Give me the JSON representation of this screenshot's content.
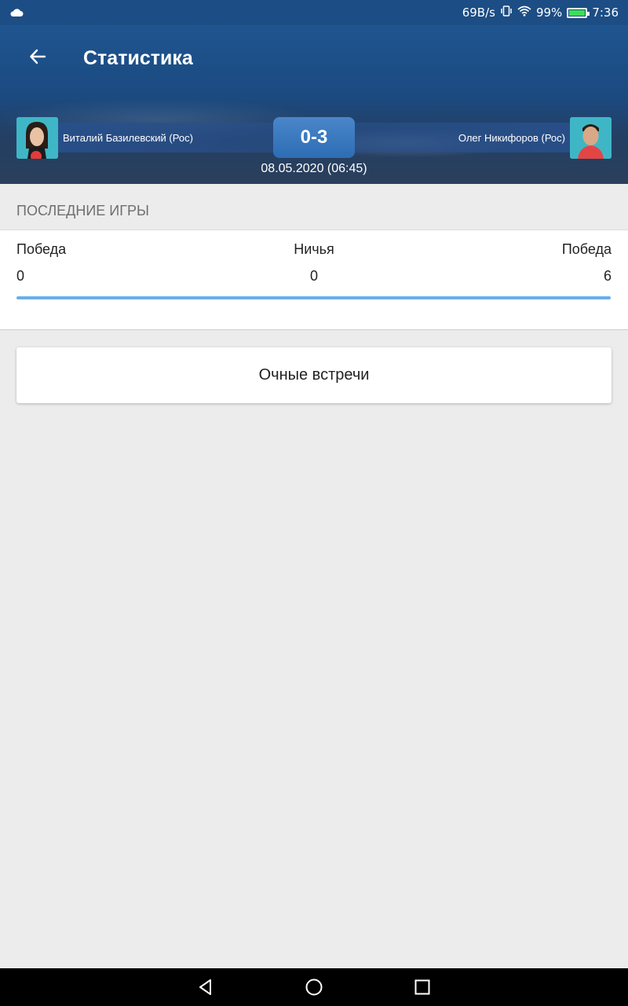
{
  "status_bar": {
    "net_speed": "69B/s",
    "battery_percent": "99%",
    "time": "7:36",
    "icons": [
      "cloud-icon",
      "vibrate-icon",
      "wifi-icon",
      "battery-icon"
    ],
    "battery_level": 0.99
  },
  "header": {
    "title": "Статистика",
    "back_icon": "arrow-left-icon",
    "accent_color": "#1f5590"
  },
  "match": {
    "player_left": "Виталий Базилевский (Рос)",
    "player_right": "Олег Никифоров (Рос)",
    "score": "0-3",
    "date": "08.05.2020 (06:45)"
  },
  "last_games": {
    "section_title": "ПОСЛЕДНИЕ ИГРЫ",
    "left_label": "Победа",
    "center_label": "Ничья",
    "right_label": "Победа",
    "left_value": "0",
    "center_value": "0",
    "right_value": "6",
    "bar_fill_fraction": 1.0,
    "bar_color": "#6aaee8"
  },
  "h2h_button": {
    "label": "Очные встречи"
  },
  "nav_bar": {
    "icons": [
      "back-triangle-icon",
      "home-circle-icon",
      "recents-square-icon"
    ]
  }
}
